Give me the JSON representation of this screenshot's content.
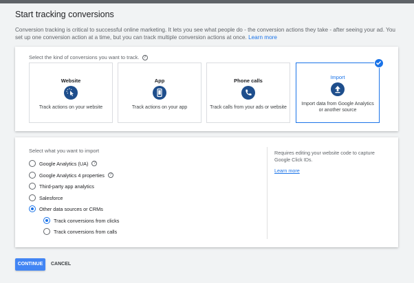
{
  "page": {
    "title": "Start tracking conversions",
    "description": "Conversion tracking is critical to successful online marketing. It lets you see what people do - the conversion actions they take - after seeing your ad. You set up one conversion action at a time, but you can track multiple conversion actions at once.",
    "learn_more": "Learn more"
  },
  "kind": {
    "label": "Select the kind of conversions you want to track.",
    "options": [
      {
        "title": "Website",
        "text": "Track actions on your website",
        "icon": "cursor-click-icon"
      },
      {
        "title": "App",
        "text": "Track actions on your app",
        "icon": "smartphone-icon"
      },
      {
        "title": "Phone calls",
        "text": "Track calls from your ads or website",
        "icon": "phone-icon"
      },
      {
        "title": "Import",
        "text": "Import data from Google Analytics or another source",
        "icon": "upload-icon",
        "selected": true
      }
    ]
  },
  "import": {
    "label": "Select what you want to import",
    "options": [
      {
        "label": "Google Analytics (UA)",
        "selected": false,
        "help": true
      },
      {
        "label": "Google Analytics 4 properties",
        "selected": false,
        "help": true
      },
      {
        "label": "Third-party app analytics",
        "selected": false
      },
      {
        "label": "Salesforce",
        "selected": false
      },
      {
        "label": "Other data sources or CRMs",
        "selected": true
      }
    ],
    "sub_options": [
      {
        "label": "Track conversions from clicks",
        "selected": true
      },
      {
        "label": "Track conversions from calls",
        "selected": false
      }
    ],
    "note": "Requires editing your website code to capture Google Click IDs.",
    "note_link": "Learn more"
  },
  "actions": {
    "continue": "CONTINUE",
    "cancel": "CANCEL"
  },
  "colors": {
    "accent": "#1a73e8",
    "icon_bg": "#1e4e8c",
    "button": "#4285f4"
  }
}
